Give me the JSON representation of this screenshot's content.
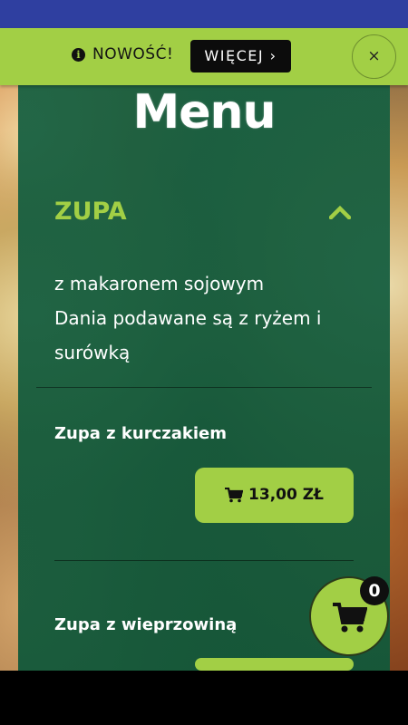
{
  "banner": {
    "text": "NOWOŚĆ!",
    "more_label": "WIĘCEJ ›",
    "close_label": "×"
  },
  "menu": {
    "title": "Menu"
  },
  "section": {
    "title": "ZUPA",
    "description_lines": [
      "z makaronem sojowym",
      "Dania podawane są z ryżem i",
      "surówką"
    ]
  },
  "items": [
    {
      "name": "Zupa z kurczakiem",
      "price": "13,00 ZŁ"
    },
    {
      "name": "Zupa z wieprzowiną",
      "price": ""
    }
  ],
  "cart": {
    "count": "0"
  },
  "colors": {
    "accent": "#a2cf45",
    "panel": "#145f41",
    "status_bar": "#2f3fa0"
  }
}
